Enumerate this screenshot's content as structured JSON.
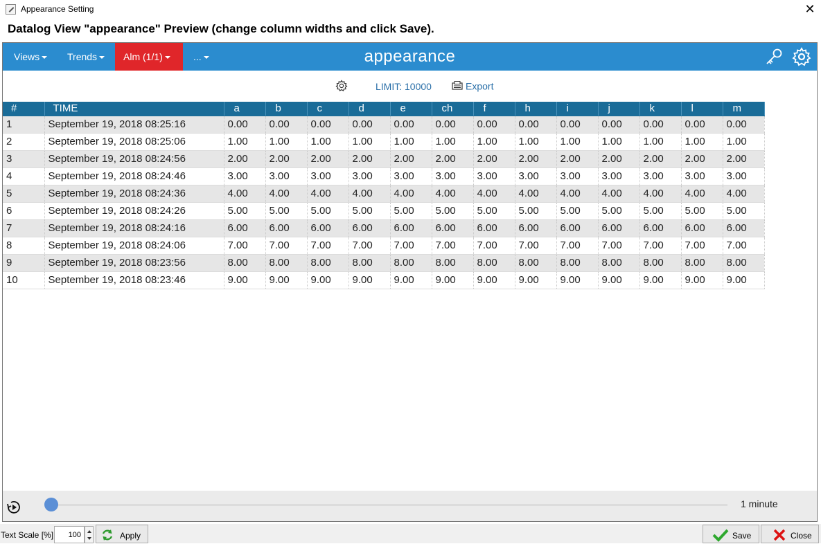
{
  "window": {
    "title": "Appearance Setting"
  },
  "heading": "Datalog View \"appearance\" Preview (change column widths and click Save).",
  "navbar": {
    "views": "Views",
    "trends": "Trends",
    "alm": "Alm (1/1)",
    "more": "...",
    "title": "appearance",
    "accent": "#2b8ccf",
    "alarm_color": "#e0262a"
  },
  "toolbar": {
    "limit": "LIMIT: 10000",
    "export": "Export"
  },
  "table": {
    "columns": [
      "#",
      "TIME",
      "a",
      "b",
      "c",
      "d",
      "e",
      "ch",
      "f",
      "h",
      "i",
      "j",
      "k",
      "l",
      "m"
    ],
    "rows": [
      [
        "1",
        "September 19, 2018 08:25:16",
        "0.00",
        "0.00",
        "0.00",
        "0.00",
        "0.00",
        "0.00",
        "0.00",
        "0.00",
        "0.00",
        "0.00",
        "0.00",
        "0.00",
        "0.00"
      ],
      [
        "2",
        "September 19, 2018 08:25:06",
        "1.00",
        "1.00",
        "1.00",
        "1.00",
        "1.00",
        "1.00",
        "1.00",
        "1.00",
        "1.00",
        "1.00",
        "1.00",
        "1.00",
        "1.00"
      ],
      [
        "3",
        "September 19, 2018 08:24:56",
        "2.00",
        "2.00",
        "2.00",
        "2.00",
        "2.00",
        "2.00",
        "2.00",
        "2.00",
        "2.00",
        "2.00",
        "2.00",
        "2.00",
        "2.00"
      ],
      [
        "4",
        "September 19, 2018 08:24:46",
        "3.00",
        "3.00",
        "3.00",
        "3.00",
        "3.00",
        "3.00",
        "3.00",
        "3.00",
        "3.00",
        "3.00",
        "3.00",
        "3.00",
        "3.00"
      ],
      [
        "5",
        "September 19, 2018 08:24:36",
        "4.00",
        "4.00",
        "4.00",
        "4.00",
        "4.00",
        "4.00",
        "4.00",
        "4.00",
        "4.00",
        "4.00",
        "4.00",
        "4.00",
        "4.00"
      ],
      [
        "6",
        "September 19, 2018 08:24:26",
        "5.00",
        "5.00",
        "5.00",
        "5.00",
        "5.00",
        "5.00",
        "5.00",
        "5.00",
        "5.00",
        "5.00",
        "5.00",
        "5.00",
        "5.00"
      ],
      [
        "7",
        "September 19, 2018 08:24:16",
        "6.00",
        "6.00",
        "6.00",
        "6.00",
        "6.00",
        "6.00",
        "6.00",
        "6.00",
        "6.00",
        "6.00",
        "6.00",
        "6.00",
        "6.00"
      ],
      [
        "8",
        "September 19, 2018 08:24:06",
        "7.00",
        "7.00",
        "7.00",
        "7.00",
        "7.00",
        "7.00",
        "7.00",
        "7.00",
        "7.00",
        "7.00",
        "7.00",
        "7.00",
        "7.00"
      ],
      [
        "9",
        "September 19, 2018 08:23:56",
        "8.00",
        "8.00",
        "8.00",
        "8.00",
        "8.00",
        "8.00",
        "8.00",
        "8.00",
        "8.00",
        "8.00",
        "8.00",
        "8.00",
        "8.00"
      ],
      [
        "10",
        "September 19, 2018 08:23:46",
        "9.00",
        "9.00",
        "9.00",
        "9.00",
        "9.00",
        "9.00",
        "9.00",
        "9.00",
        "9.00",
        "9.00",
        "9.00",
        "9.00",
        "9.00"
      ]
    ]
  },
  "timeline": {
    "label": "1 minute",
    "position": 0
  },
  "footer": {
    "text_scale_label": "Text Scale [%]:",
    "text_scale_value": "100",
    "apply": "Apply",
    "save": "Save",
    "close": "Close"
  },
  "icons": {
    "nav_right_1": "key-icon",
    "nav_right_2": "gear-icon",
    "toolbar_settings": "gear-icon",
    "toolbar_export": "export-icon",
    "replay": "replay-icon",
    "apply": "refresh-icon",
    "save": "checkmark-icon",
    "close": "close-icon"
  }
}
